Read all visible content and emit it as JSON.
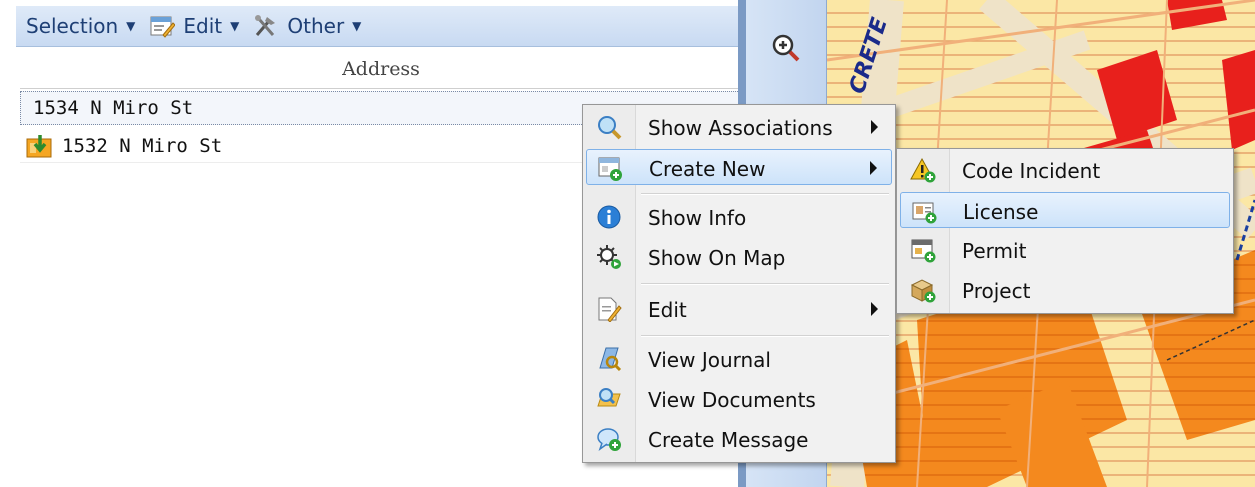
{
  "toolbar": {
    "selection_label": "Selection",
    "edit_label": "Edit",
    "other_label": "Other"
  },
  "grid": {
    "column_header": "Address",
    "rows": [
      {
        "address": "1534 N Miro St",
        "icon": "none"
      },
      {
        "address": "1532 N Miro St",
        "icon": "property-icon"
      }
    ]
  },
  "map": {
    "street_label": "CRETE"
  },
  "context_menu": {
    "items": [
      {
        "label": "Show Associations",
        "icon": "magnifier-icon",
        "submenu": true
      },
      {
        "label": "Create New",
        "icon": "form-add-icon",
        "submenu": true,
        "highlighted": true
      },
      {
        "label": "Show Info",
        "icon": "info-icon",
        "submenu": false
      },
      {
        "label": "Show On Map",
        "icon": "map-locate-icon",
        "submenu": false
      },
      {
        "label": "Edit",
        "icon": "edit-document-icon",
        "submenu": true
      },
      {
        "label": "View Journal",
        "icon": "journal-icon",
        "submenu": false
      },
      {
        "label": "View Documents",
        "icon": "documents-icon",
        "submenu": false
      },
      {
        "label": "Create Message",
        "icon": "message-add-icon",
        "submenu": false
      }
    ]
  },
  "create_submenu": {
    "items": [
      {
        "label": "Code Incident",
        "icon": "warning-add-icon"
      },
      {
        "label": "License",
        "icon": "license-add-icon",
        "highlighted": true
      },
      {
        "label": "Permit",
        "icon": "permit-add-icon"
      },
      {
        "label": "Project",
        "icon": "project-add-icon"
      }
    ]
  },
  "colors": {
    "toolbar_text": "#1e3f75",
    "menu_highlight": "#cde3fa",
    "map_red": "#e8201c",
    "map_orange": "#f4891e",
    "map_yellow": "#fbe7a5"
  }
}
